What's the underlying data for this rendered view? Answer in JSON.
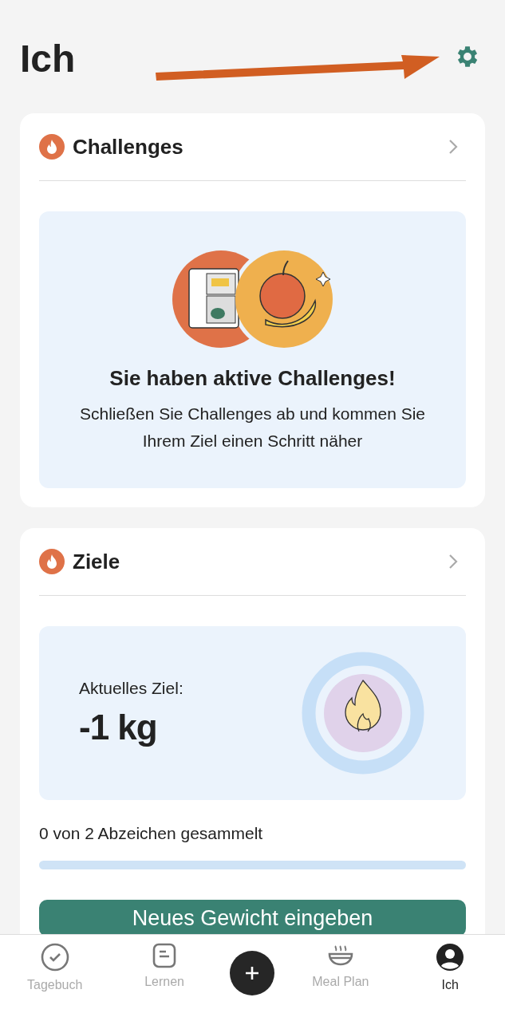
{
  "header": {
    "title": "Ich"
  },
  "challenges": {
    "title": "Challenges",
    "heading": "Sie haben aktive Challenges!",
    "text": "Schließen Sie Challenges ab und kommen Sie Ihrem Ziel einen Schritt näher"
  },
  "goals": {
    "title": "Ziele",
    "label": "Aktuelles Ziel:",
    "value": "-1 kg",
    "badges_text": "0 von 2 Abzeichen gesammelt",
    "progress": {
      "level": 0
    },
    "button": "Neues Gewicht eingeben"
  },
  "tabs": [
    {
      "kind": "check",
      "label": "Tagebuch",
      "selected": false
    },
    {
      "kind": "note",
      "label": "Lernen",
      "selected": false
    },
    {
      "kind": "plus",
      "selected": false
    },
    {
      "kind": "bowl",
      "label": "Meal Plan",
      "selected": false
    },
    {
      "kind": "person",
      "label": "Ich",
      "selected": true
    }
  ]
}
